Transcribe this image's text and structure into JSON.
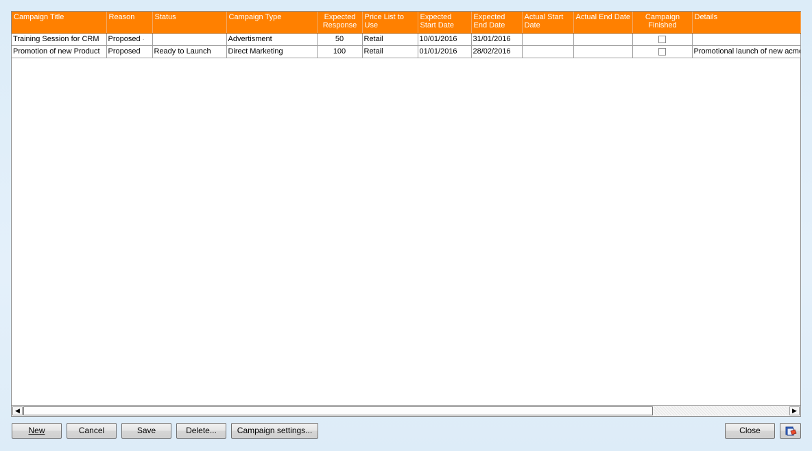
{
  "grid": {
    "columns": [
      "Campaign Title",
      "Reason",
      "Status",
      "Campaign Type",
      "Expected Response",
      "Price List to Use",
      "Expected Start Date",
      "Expected End Date",
      "Actual Start Date",
      "Actual End Date",
      "Campaign Finished",
      "Details"
    ],
    "rows": [
      {
        "title": "Training Session for CRM",
        "reason": "Proposed",
        "status": "",
        "type": "Advertisment",
        "response": "50",
        "price_list": "Retail",
        "exp_start": "10/01/2016",
        "exp_end": "31/01/2016",
        "act_start": "",
        "act_end": "",
        "finished": false,
        "details": ""
      },
      {
        "title": "Promotion of new Product",
        "reason": "Proposed",
        "status": "Ready to Launch",
        "type": "Direct Marketing",
        "response": "100",
        "price_list": "Retail",
        "exp_start": "01/01/2016",
        "exp_end": "28/02/2016",
        "act_start": "",
        "act_end": "",
        "finished": false,
        "details": "Promotional launch of new acme"
      }
    ]
  },
  "buttons": {
    "new_label": "New",
    "cancel_label": "Cancel",
    "save_label": "Save",
    "delete_label": "Delete...",
    "campaign_settings_label": "Campaign settings...",
    "close_label": "Close"
  },
  "colors": {
    "header_bg": "#ff8000",
    "header_text": "#ffffff"
  }
}
